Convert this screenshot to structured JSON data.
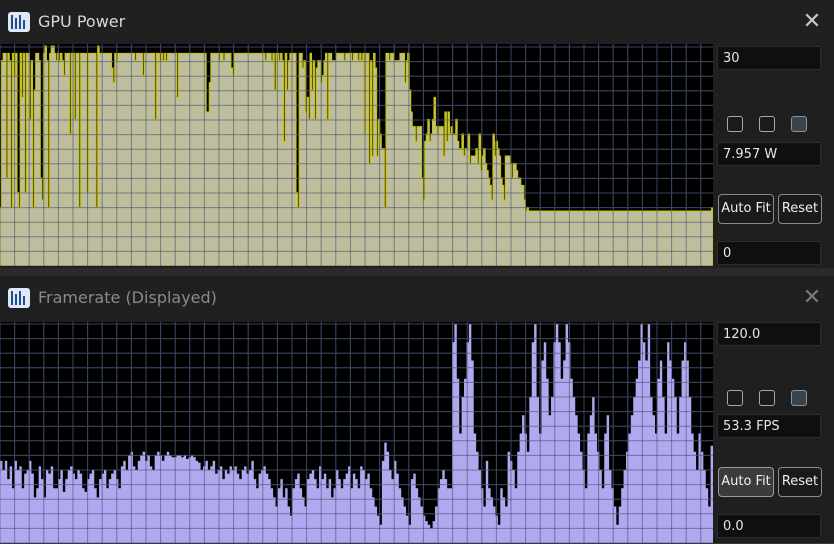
{
  "windows": [
    {
      "title": "GPU Power",
      "max_field": "30",
      "current_field": "7.957 W",
      "min_field": "0",
      "auto_fit_label": "Auto Fit",
      "reset_label": "Reset",
      "checkboxes": [
        false,
        false,
        true
      ]
    },
    {
      "title": "Framerate (Displayed)",
      "max_field": "120.0",
      "current_field": "53.3 FPS",
      "min_field": "0.0",
      "auto_fit_label": "Auto Fit",
      "reset_label": "Reset",
      "checkboxes": [
        false,
        false,
        true
      ]
    }
  ],
  "colors": {
    "power_fill": "#bebd9c",
    "power_edge": "#c8c400",
    "fps_fill": "#b0a9f0",
    "grid": "#3b4660",
    "plot_bg": "#000000"
  },
  "chart_data": [
    {
      "type": "area",
      "ylim": [
        0,
        30
      ],
      "values": [
        8,
        28,
        29,
        29,
        12,
        29,
        28,
        8,
        29,
        26,
        29,
        10,
        8,
        29,
        23,
        29,
        10,
        29,
        29,
        20,
        28,
        8,
        24,
        29,
        29,
        28,
        12,
        9,
        29,
        30,
        28,
        8,
        29,
        30,
        30,
        29,
        28,
        29,
        28,
        29,
        28,
        26,
        29,
        29,
        29,
        18,
        29,
        29,
        20,
        29,
        29,
        8,
        29,
        29,
        29,
        29,
        10,
        29,
        29,
        29,
        29,
        29,
        8,
        30,
        29,
        29,
        29,
        29,
        29,
        29,
        29,
        29,
        27,
        25,
        29,
        28,
        29,
        29,
        29,
        29,
        29,
        29,
        29,
        29,
        29,
        29,
        29,
        28,
        29,
        29,
        29,
        29,
        26,
        29,
        29,
        29,
        29,
        29,
        29,
        29,
        20,
        29,
        29,
        28,
        29,
        28,
        29,
        28,
        29,
        29,
        29,
        29,
        29,
        29,
        23,
        29,
        29,
        29,
        29,
        29,
        29,
        29,
        29,
        29,
        29,
        29,
        29,
        29,
        29,
        29,
        29,
        29,
        29,
        21,
        21,
        25,
        29,
        29,
        29,
        29,
        29,
        28,
        29,
        29,
        28,
        29,
        29,
        29,
        29,
        27,
        26,
        29,
        29,
        29,
        29,
        29,
        29,
        29,
        29,
        29,
        29,
        29,
        29,
        29,
        29,
        29,
        29,
        29,
        29,
        29,
        29,
        28,
        29,
        29,
        29,
        28,
        29,
        24,
        29,
        29,
        28,
        29,
        28,
        17,
        29,
        24,
        28,
        29,
        29,
        29,
        29,
        10,
        8,
        29,
        29,
        27,
        28,
        21,
        23,
        20,
        29,
        24,
        28,
        20,
        27,
        28,
        28,
        25,
        26,
        28,
        29,
        20,
        29,
        29,
        28,
        28,
        28,
        29,
        29,
        29,
        29,
        29,
        28,
        29,
        29,
        29,
        29,
        28,
        29,
        29,
        29,
        28,
        29,
        28,
        29,
        18,
        29,
        29,
        14,
        28,
        15,
        29,
        27,
        15,
        20,
        18,
        16,
        16,
        8,
        29,
        29,
        28,
        29,
        29,
        28,
        28,
        28,
        28,
        29,
        29,
        29,
        25,
        28,
        29,
        24,
        21,
        19,
        19,
        17,
        19,
        19,
        19,
        12,
        9,
        17,
        18,
        20,
        17,
        18,
        20,
        23,
        19,
        18,
        19,
        19,
        19,
        15,
        21,
        17,
        21,
        18,
        19,
        18,
        18,
        20,
        17,
        16,
        16,
        18,
        15,
        16,
        16,
        18,
        14,
        15,
        15,
        15,
        16,
        14,
        18,
        13,
        15,
        16,
        14,
        13,
        12,
        11,
        9,
        18,
        15,
        17,
        16,
        15,
        12,
        11,
        9,
        15,
        15,
        15,
        14,
        12,
        14,
        14,
        13,
        12,
        12,
        11,
        11,
        9,
        7.5,
        8,
        7.5,
        7.5,
        7.5,
        7.5,
        7.5,
        7.5,
        7.5,
        7.5,
        7.5,
        7.5,
        7.5,
        7.5,
        7.5,
        7.5,
        7.5,
        7.5,
        7.5,
        7.5,
        7.5,
        7.5,
        7.5,
        7.5,
        7.5,
        7.5,
        7.5,
        7.5,
        7.5,
        7.5,
        7.5,
        7.5,
        7.5,
        7.5,
        7.5,
        7.5,
        7.5,
        7.5,
        7.5,
        7.5,
        7.5,
        7.5,
        7.5,
        7.5,
        7.5,
        7.5,
        7.5,
        7.5,
        7.5,
        7.5,
        7.5,
        7.5,
        7.5,
        7.5,
        7.5,
        7.5,
        7.5,
        7.5,
        7.5,
        7.5,
        7.5,
        7.5,
        7.5,
        7.5,
        7.5,
        7.5,
        7.5,
        7.5,
        7.5,
        7.5,
        7.5,
        7.5,
        7.5,
        7.5,
        7.5,
        7.5,
        7.5,
        7.5,
        7.5,
        7.5,
        7.5,
        7.5,
        7.5,
        7.5,
        7.5,
        7.5,
        7.5,
        7.5,
        7.5,
        7.5,
        7.5,
        7.5,
        7.5,
        7.5,
        7.5,
        7.5,
        7.5,
        7.5,
        7.5,
        7.5,
        7.5,
        7.5,
        7.5,
        7.5,
        7.5,
        7.5,
        7.5,
        7.5,
        7.5,
        7.5,
        7.5,
        7.5,
        7.5,
        7.5,
        7.5,
        7.5,
        7.5,
        7.5,
        7.5,
        7.5,
        7.957
      ]
    },
    {
      "type": "area",
      "ylim": [
        0,
        120
      ],
      "values": [
        45,
        40,
        45,
        35,
        42,
        30,
        45,
        40,
        42,
        30,
        38,
        40,
        45,
        38,
        25,
        30,
        42,
        35,
        25,
        40,
        38,
        42,
        30,
        30,
        35,
        40,
        28,
        35,
        40,
        42,
        38,
        35,
        40,
        38,
        30,
        28,
        35,
        38,
        40,
        30,
        25,
        35,
        38,
        40,
        30,
        35,
        38,
        40,
        35,
        30,
        42,
        45,
        40,
        48,
        50,
        42,
        40,
        45,
        48,
        50,
        45,
        48,
        42,
        40,
        48,
        50,
        48,
        45,
        48,
        50,
        48,
        47,
        47,
        48,
        48,
        47,
        48,
        46,
        47,
        48,
        47,
        45,
        44,
        40,
        42,
        45,
        40,
        42,
        45,
        38,
        40,
        42,
        35,
        40,
        38,
        42,
        40,
        42,
        38,
        35,
        40,
        42,
        38,
        40,
        45,
        35,
        30,
        38,
        40,
        42,
        38,
        35,
        30,
        25,
        20,
        30,
        35,
        25,
        30,
        20,
        15,
        30,
        35,
        38,
        30,
        25,
        20,
        35,
        38,
        40,
        35,
        30,
        42,
        35,
        38,
        30,
        35,
        25,
        30,
        40,
        35,
        30,
        35,
        38,
        42,
        30,
        38,
        35,
        30,
        42,
        40,
        35,
        38,
        30,
        25,
        20,
        15,
        10,
        45,
        55,
        50,
        40,
        35,
        45,
        38,
        30,
        25,
        20,
        15,
        10,
        35,
        38,
        30,
        25,
        20,
        15,
        12,
        10,
        8,
        12,
        20,
        30,
        35,
        40,
        35,
        30,
        30,
        110,
        120,
        90,
        60,
        80,
        90,
        110,
        120,
        100,
        60,
        50,
        40,
        30,
        20,
        45,
        30,
        25,
        20,
        15,
        10,
        30,
        25,
        20,
        50,
        45,
        40,
        30,
        50,
        60,
        70,
        60,
        50,
        80,
        110,
        120,
        80,
        60,
        100,
        110,
        90,
        70,
        80,
        110,
        120,
        110,
        90,
        100,
        120,
        110,
        90,
        80,
        70,
        60,
        50,
        40,
        30,
        60,
        70,
        80,
        60,
        50,
        40,
        30,
        60,
        70,
        40,
        30,
        20,
        10,
        20,
        30,
        40,
        50,
        60,
        70,
        80,
        90,
        100,
        120,
        110,
        100,
        120,
        80,
        70,
        60,
        90,
        100,
        80,
        60,
        110,
        100,
        90,
        80,
        60,
        80,
        100,
        110,
        100,
        80,
        60,
        50,
        40,
        60,
        50,
        40,
        30,
        20,
        53.3
      ]
    }
  ]
}
